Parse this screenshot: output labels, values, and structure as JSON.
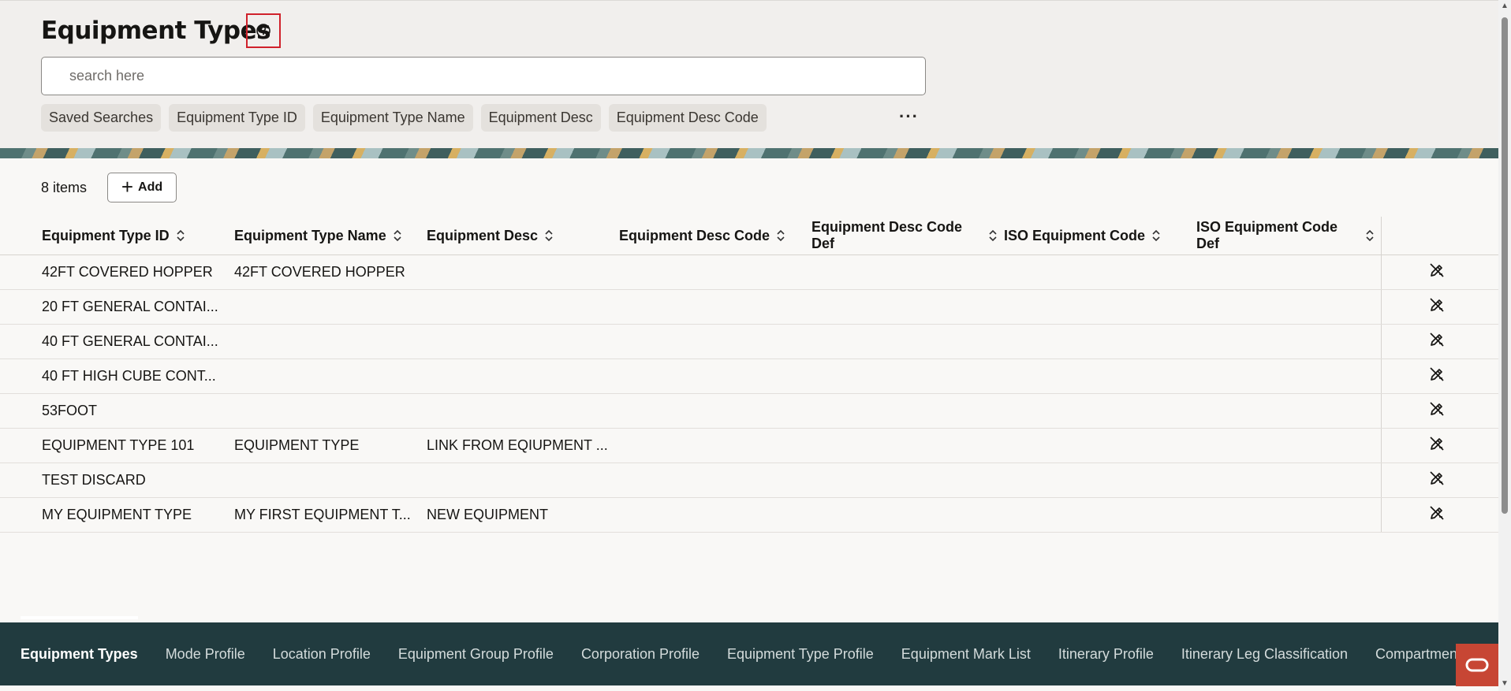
{
  "page": {
    "title": "Equipment Types",
    "search_placeholder": "search here"
  },
  "filters": [
    "Saved Searches",
    "Equipment Type ID",
    "Equipment Type Name",
    "Equipment Desc",
    "Equipment Desc Code"
  ],
  "more_label": "···",
  "toolbar": {
    "count": "8 items",
    "add_label": "Add"
  },
  "columns": [
    "Equipment Type ID",
    "Equipment Type Name",
    "Equipment Desc",
    "Equipment Desc Code",
    "Equipment Desc Code Def",
    "ISO Equipment Code",
    "ISO Equipment Code Def"
  ],
  "rows": [
    [
      "42FT COVERED HOPPER",
      "42FT COVERED HOPPER",
      "",
      "",
      "",
      "",
      ""
    ],
    [
      "20 FT GENERAL CONTAI...",
      "",
      "",
      "",
      "",
      "",
      ""
    ],
    [
      "40 FT GENERAL CONTAI...",
      "",
      "",
      "",
      "",
      "",
      ""
    ],
    [
      "40 FT HIGH CUBE CONT...",
      "",
      "",
      "",
      "",
      "",
      ""
    ],
    [
      "53FOOT",
      "",
      "",
      "",
      "",
      "",
      ""
    ],
    [
      "EQUIPMENT TYPE 101",
      "EQUIPMENT TYPE",
      "LINK FROM EQIUPMENT ...",
      "",
      "",
      "",
      ""
    ],
    [
      "TEST DISCARD",
      "",
      "",
      "",
      "",
      "",
      ""
    ],
    [
      "MY EQUIPMENT TYPE",
      "MY FIRST EQUIPMENT T...",
      "NEW EQUIPMENT",
      "",
      "",
      "",
      ""
    ]
  ],
  "footer_tabs": [
    "Equipment Types",
    "Mode Profile",
    "Location Profile",
    "Equipment Group Profile",
    "Corporation Profile",
    "Equipment Type Profile",
    "Equipment Mark List",
    "Itinerary Profile",
    "Itinerary Leg Classification",
    "Compartment"
  ],
  "colors": {
    "footer_bg": "#213b3f",
    "accent_red": "#c74634",
    "help_border": "#d0212b"
  }
}
